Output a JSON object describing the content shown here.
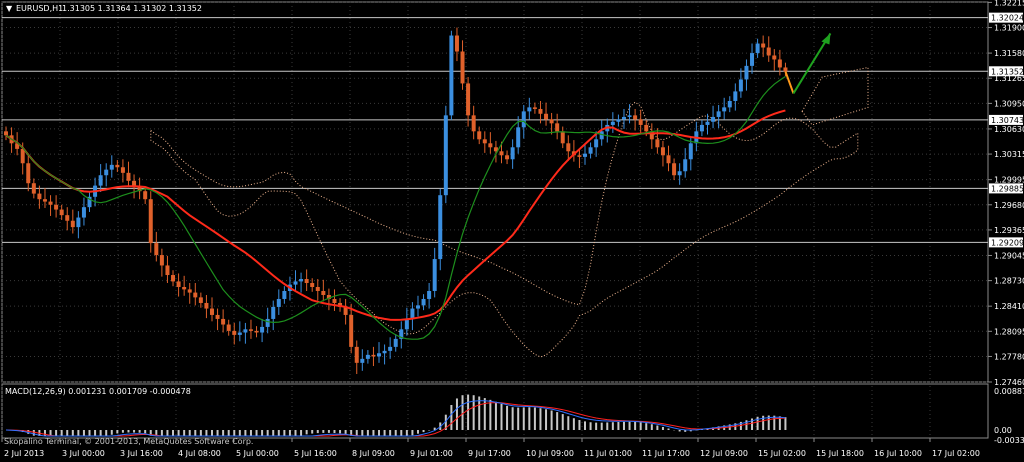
{
  "window": {
    "symbol_header": "EURUSD,H1",
    "ohlc": "1.31305 1.31364 1.31302 1.31352",
    "menu_glyph": "▼"
  },
  "watermark": "Skopalino Terminal, © 2001-2013, MetaQuotes Software Corp.",
  "colors": {
    "background": "#000000",
    "grid": "#3a3a3a",
    "bull_candle": "#3b8fe0",
    "bear_candle": "#e0612b",
    "ma_fast": "#ff2a1a",
    "ma_slow": "#1d8f1d",
    "cloud": "#f3b892",
    "hline": "#c8c8c8",
    "arrow_up": "#1fa21f",
    "arrow_down": "#ff9a1a",
    "macd_hist": "#c8c8c8",
    "macd_signal": "#ff2020",
    "macd_line": "#3070ff"
  },
  "price_axis": {
    "labels": [
      "1.32215",
      "1.31900",
      "1.31580",
      "1.31265",
      "1.30950",
      "1.30630",
      "1.30315",
      "1.29995",
      "1.29680",
      "1.29365",
      "1.29045",
      "1.28730",
      "1.28410",
      "1.28095",
      "1.27780",
      "1.27460"
    ],
    "highlighted": [
      {
        "value": "1.32024"
      },
      {
        "value": "1.31352"
      },
      {
        "value": "1.30743"
      },
      {
        "value": "1.29885"
      },
      {
        "value": "1.29209"
      }
    ]
  },
  "time_axis": {
    "labels": [
      "2 Jul 2013",
      "3 Jul 00:00",
      "3 Jul 16:00",
      "4 Jul 08:00",
      "5 Jul 00:00",
      "5 Jul 16:00",
      "8 Jul 09:00",
      "9 Jul 01:00",
      "9 Jul 17:00",
      "10 Jul 09:00",
      "11 Jul 01:00",
      "11 Jul 17:00",
      "12 Jul 09:00",
      "15 Jul 02:00",
      "15 Jul 18:00",
      "16 Jul 10:00",
      "17 Jul 02:00"
    ]
  },
  "macd": {
    "label": "MACD(12,26,9) 0.001231 0.001709 -0.000478",
    "axis_labels": [
      "0.00887",
      "0.00",
      "-0.00336"
    ]
  },
  "chart_data": {
    "type": "candlestick",
    "symbol": "EURUSD",
    "timeframe": "H1",
    "ylim": [
      1.2746,
      1.3222
    ],
    "closes": [
      1.3055,
      1.3045,
      1.3038,
      1.302,
      1.2995,
      1.2982,
      1.2975,
      1.2972,
      1.2968,
      1.2962,
      1.2955,
      1.2948,
      1.294,
      1.2952,
      1.2965,
      1.2978,
      1.2992,
      1.3005,
      1.3012,
      1.3018,
      1.3015,
      1.3008,
      1.2998,
      1.299,
      1.2985,
      1.2975,
      1.292,
      1.2905,
      1.2892,
      1.288,
      1.2872,
      1.2865,
      1.2862,
      1.2858,
      1.2852,
      1.2845,
      1.2838,
      1.283,
      1.2825,
      1.2818,
      1.281,
      1.2805,
      1.2808,
      1.2812,
      1.281,
      1.2808,
      1.2815,
      1.2825,
      1.284,
      1.285,
      1.286,
      1.2868,
      1.2872,
      1.2875,
      1.287,
      1.2865,
      1.286,
      1.2855,
      1.285,
      1.2845,
      1.284,
      1.283,
      1.279,
      1.277,
      1.2775,
      1.278,
      1.2778,
      1.2782,
      1.2785,
      1.279,
      1.28,
      1.2812,
      1.2825,
      1.2838,
      1.2842,
      1.285,
      1.286,
      1.29,
      1.298,
      1.308,
      1.318,
      1.316,
      1.312,
      1.308,
      1.306,
      1.305,
      1.3045,
      1.304,
      1.3035,
      1.303,
      1.3025,
      1.304,
      1.3065,
      1.3085,
      1.309,
      1.3088,
      1.3082,
      1.3075,
      1.307,
      1.306,
      1.3045,
      1.3035,
      1.303,
      1.3028,
      1.3032,
      1.304,
      1.305,
      1.306,
      1.3068,
      1.3072,
      1.3075,
      1.3078,
      1.308,
      1.3075,
      1.3068,
      1.306,
      1.305,
      1.304,
      1.303,
      1.302,
      1.3005,
      1.301,
      1.3025,
      1.3045,
      1.306,
      1.3068,
      1.3072,
      1.3078,
      1.3085,
      1.309,
      1.3098,
      1.311,
      1.3125,
      1.3142,
      1.3158,
      1.317,
      1.3165,
      1.3155,
      1.315,
      1.314,
      1.3135
    ],
    "overlays": [
      "Ichimoku cloud",
      "moving average (red)",
      "moving average (green)"
    ],
    "sub_indicator": {
      "name": "MACD",
      "params": [
        12,
        26,
        9
      ],
      "values": [
        0.001231,
        0.001709,
        -0.000478
      ]
    }
  }
}
